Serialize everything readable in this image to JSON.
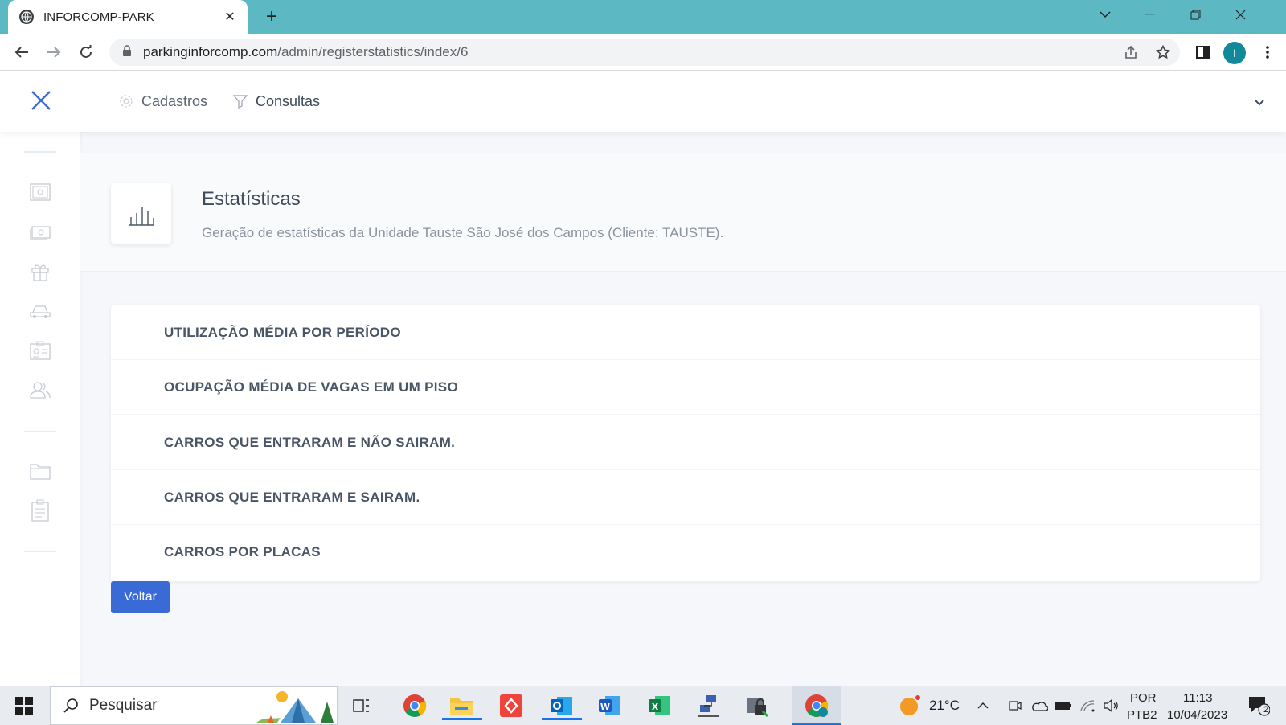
{
  "browser": {
    "tab_title": "INFORCOMP-PARK",
    "url_host": "parkinginforcomp.com",
    "url_path": "/admin/registerstatistics/index/6",
    "profile_initial": "I"
  },
  "menu": {
    "cadastros": "Cadastros",
    "consultas": "Consultas"
  },
  "page": {
    "title": "Estatísticas",
    "subtitle": "Geração de estatísticas da Unidade Tauste São José dos Campos (Cliente: TAUSTE)."
  },
  "stats": [
    "UTILIZAÇÃO MÉDIA POR PERÍODO",
    "OCUPAÇÃO MÉDIA DE VAGAS EM UM PISO",
    "CARROS QUE ENTRARAM E NÃO SAIRAM.",
    "CARROS QUE ENTRARAM E SAIRAM.",
    "CARROS POR PLACAS"
  ],
  "back_label": "Voltar",
  "taskbar": {
    "search_placeholder": "Pesquisar",
    "temperature": "21°C",
    "lang_1": "POR",
    "lang_2": "PTB2",
    "time": "11:13",
    "date": "10/04/2023",
    "notification_count": "2"
  },
  "colors": {
    "tabstrip": "#5cb8c2",
    "primary_button": "#3a6ad6",
    "close_x": "#3a6ad6"
  }
}
